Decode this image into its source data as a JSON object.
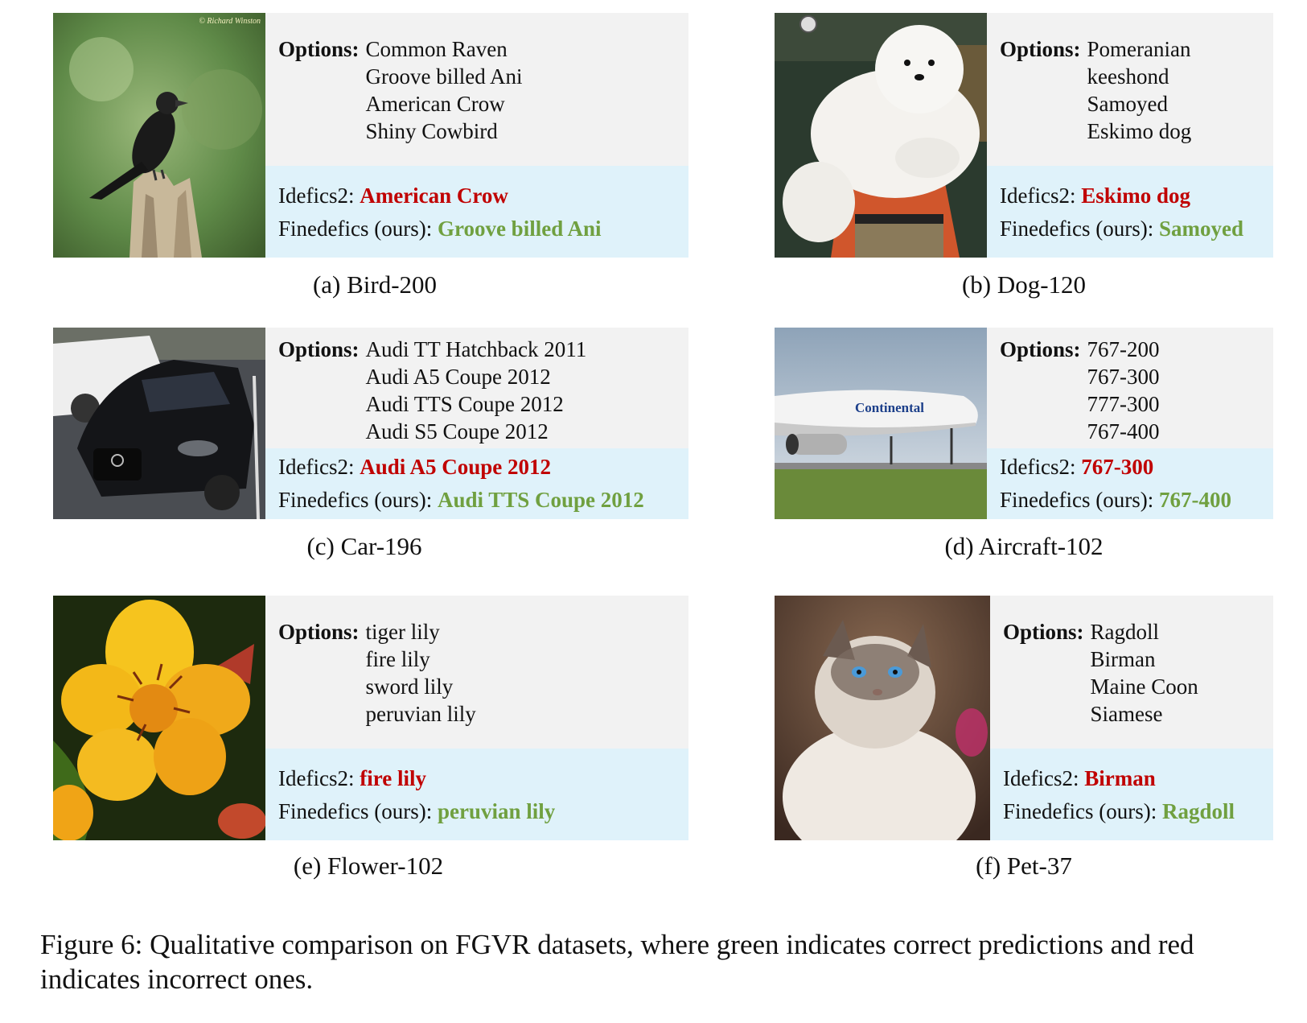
{
  "panels": [
    {
      "id": "a",
      "sublabel": "(a) Bird-200",
      "image_subject": "black bird perched on a broken wooden stump",
      "watermark": "© Richard Winston",
      "options_label": "Options:",
      "options": [
        "Common Raven",
        "Groove billed Ani",
        "American Crow",
        "Shiny Cowbird"
      ],
      "baseline_label": "Idefics2:",
      "baseline_pred": "American Crow",
      "ours_label": "Finedefics (ours):",
      "ours_pred": "Groove billed Ani"
    },
    {
      "id": "b",
      "sublabel": "(b) Dog-120",
      "image_subject": "person holding a large fluffy white dog",
      "options_label": "Options:",
      "options": [
        "Pomeranian",
        "keeshond",
        "Samoyed",
        "Eskimo dog"
      ],
      "baseline_label": "Idefics2:",
      "baseline_pred": "Eskimo dog",
      "ours_label": "Finedefics (ours):",
      "ours_pred": "Samoyed"
    },
    {
      "id": "c",
      "sublabel": "(c) Car-196",
      "image_subject": "black Audi coupe parked next to a white SUV",
      "options_label": "Options:",
      "options": [
        "Audi TT Hatchback 2011",
        "Audi A5 Coupe 2012",
        "Audi TTS Coupe 2012",
        "Audi S5 Coupe 2012"
      ],
      "baseline_label": "Idefics2:",
      "baseline_pred": "Audi A5 Coupe 2012",
      "ours_label": "Finedefics (ours):",
      "ours_pred": "Audi TTS Coupe 2012"
    },
    {
      "id": "d",
      "sublabel": "(d) Aircraft-102",
      "image_subject": "Continental airliner on runway",
      "airline_text": "Continental",
      "options_label": "Options:",
      "options": [
        "767-200",
        "767-300",
        "777-300",
        "767-400"
      ],
      "baseline_label": "Idefics2:",
      "baseline_pred": "767-300",
      "ours_label": "Finedefics (ours):",
      "ours_pred": "767-400"
    },
    {
      "id": "e",
      "sublabel": "(e) Flower-102",
      "image_subject": "yellow-orange lily flower",
      "options_label": "Options:",
      "options": [
        "tiger lily",
        "fire lily",
        "sword lily",
        "peruvian lily"
      ],
      "baseline_label": "Idefics2:",
      "baseline_pred": "fire lily",
      "ours_label": "Finedefics (ours):",
      "ours_pred": "peruvian lily"
    },
    {
      "id": "f",
      "sublabel": "(f) Pet-37",
      "image_subject": "fluffy white cat with blue eyes looking up",
      "options_label": "Options:",
      "options": [
        "Ragdoll",
        "Birman",
        "Maine Coon",
        "Siamese"
      ],
      "baseline_label": "Idefics2:",
      "baseline_pred": "Birman",
      "ours_label": "Finedefics (ours):",
      "ours_pred": "Ragdoll"
    }
  ],
  "caption": "Figure 6: Qualitative comparison on FGVR datasets, where green indicates correct predictions and red indicates incorrect ones.",
  "colors": {
    "correct": "#70a040",
    "incorrect": "#c00000",
    "options_bg": "#f2f2f2",
    "preds_bg": "#dff2fa"
  }
}
